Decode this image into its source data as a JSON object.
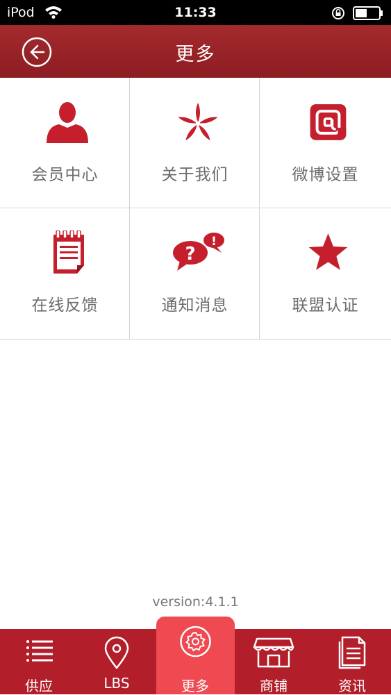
{
  "status_bar": {
    "carrier": "iPod",
    "time": "11:33"
  },
  "nav": {
    "title": "更多"
  },
  "grid": {
    "items": [
      {
        "label": "会员中心",
        "icon": "user-icon"
      },
      {
        "label": "关于我们",
        "icon": "flower-icon"
      },
      {
        "label": "微博设置",
        "icon": "at-icon"
      },
      {
        "label": "在线反馈",
        "icon": "notepad-icon"
      },
      {
        "label": "通知消息",
        "icon": "speech-bubbles-icon"
      },
      {
        "label": "联盟认证",
        "icon": "star-icon"
      }
    ]
  },
  "version": "version:4.1.1",
  "tabs": [
    {
      "label": "供应",
      "icon": "list-icon",
      "active": false
    },
    {
      "label": "LBS",
      "icon": "map-pin-icon",
      "active": false
    },
    {
      "label": "更多",
      "icon": "gear-icon",
      "active": true
    },
    {
      "label": "商铺",
      "icon": "storefront-icon",
      "active": false
    },
    {
      "label": "资讯",
      "icon": "news-icon",
      "active": false
    }
  ],
  "colors": {
    "brand_red": "#b21e29",
    "active_tab": "#ef4a52",
    "icon_red": "#c51f2d"
  }
}
